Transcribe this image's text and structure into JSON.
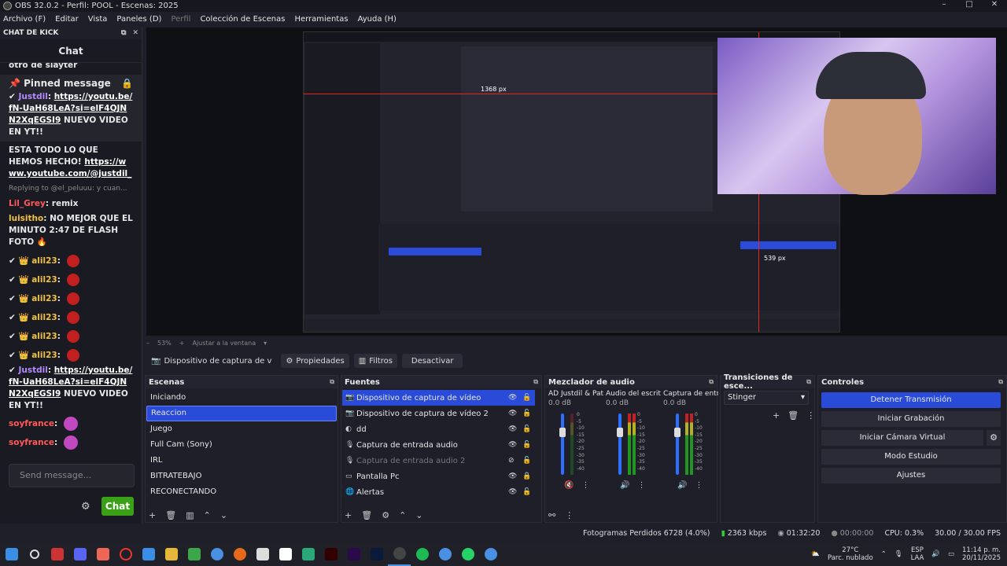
{
  "window": {
    "title": "OBS 32.0.2 - Perfil: POOL - Escenas: 2025",
    "controls": [
      "–",
      "□",
      "✕"
    ]
  },
  "menu": [
    "Archivo (F)",
    "Editar",
    "Vista",
    "Paneles (D)",
    "Perfil",
    "Colección de Escenas",
    "Herramientas",
    "Ayuda (H)"
  ],
  "chat_dock": {
    "header": "CHAT DE KICK",
    "title": "Chat",
    "top_partial": "otro de slayter",
    "pinned": {
      "label": "Pinned message",
      "user": "Justdil",
      "link": "https://youtu.be/fN-UaH68LeA?si=elF4QJNN2XqEGSI9",
      "text": "NUEVO VIDEO EN YT!!"
    },
    "messages": [
      {
        "user": "",
        "text": "ESTA TODO LO QUE HEMOS HECHO!",
        "link": "https://www.youtube.com/@justdil_"
      },
      {
        "user": "",
        "text": "Replying to @el_peluuu: y cuan...",
        "reply": true
      },
      {
        "user": "Lil_Grey",
        "text": "remix"
      },
      {
        "user": "luisitho",
        "text": "NO MEJOR QUE EL MINUTO 2:47 DE FLASH FOTO 🔥"
      },
      {
        "user": "alil23",
        "text": ""
      },
      {
        "user": "alil23",
        "text": ""
      },
      {
        "user": "alil23",
        "text": ""
      },
      {
        "user": "alil23",
        "text": ""
      },
      {
        "user": "alil23",
        "text": ""
      },
      {
        "user": "alil23",
        "text": ""
      },
      {
        "user": "Justdil",
        "text": "NUEVO VIDEO EN YT!!",
        "link": "https://youtu.be/fN-UaH68LeA?si=elF4QJNN2XqEGSI9"
      },
      {
        "user": "soyfrance",
        "text": ""
      },
      {
        "user": "soyfrance",
        "text": ""
      }
    ],
    "input_placeholder": "Send message...",
    "chat_button": "Chat"
  },
  "zoom": {
    "value": "53%",
    "fit": "Ajustar a la ventana"
  },
  "source_toolbar": {
    "source": "Dispositivo de captura de v",
    "properties": "Propiedades",
    "filters": "Filtros",
    "deactivate": "Desactivar"
  },
  "scenes": {
    "title": "Escenas",
    "items": [
      "Iniciando",
      "Reaccion",
      "Juego",
      "Full Cam (Sony)",
      "IRL",
      "BITRATEBAJO",
      "RECONECTANDO"
    ],
    "selected": 1
  },
  "sources": {
    "title": "Fuentes",
    "items": [
      {
        "name": "Dispositivo de captura de vídeo",
        "icon": "camera-icon",
        "visible": true
      },
      {
        "name": "Dispositivo de captura de vídeo 2",
        "icon": "camera-icon",
        "visible": true
      },
      {
        "name": "dd",
        "icon": "circle-icon",
        "visible": true
      },
      {
        "name": "Captura de entrada audio",
        "icon": "mic-icon",
        "visible": true
      },
      {
        "name": "Captura de entrada audio 2",
        "icon": "mic-icon",
        "visible": false
      },
      {
        "name": "Pantalla Pc",
        "icon": "monitor-icon",
        "visible": true
      },
      {
        "name": "Alertas",
        "icon": "globe-icon",
        "visible": true
      }
    ]
  },
  "mixer": {
    "title": "Mezclador de audio",
    "channels": [
      {
        "name": "AD Justdil & Patroc",
        "db": "0.0 dB",
        "level": 0.5
      },
      {
        "name": "Audio del escritorio",
        "db": "0.0 dB",
        "level": 0.5
      },
      {
        "name": "Captura de entrada",
        "db": "0.0 dB",
        "level": 0.5
      }
    ],
    "scale": [
      "0",
      "-5",
      "-10",
      "-15",
      "-20",
      "-25",
      "-30",
      "-35",
      "-40",
      "-45",
      "-50",
      "-55",
      "-60"
    ]
  },
  "transitions": {
    "title": "Transiciones de esce...",
    "selected": "Stinger"
  },
  "controls": {
    "title": "Controles",
    "buttons": [
      "Detener Transmisión",
      "Iniciar Grabación",
      "Iniciar Cámara Virtual",
      "Modo Estudio",
      "Ajustes"
    ]
  },
  "status": {
    "dropped": "Fotogramas Perdidos 6728 (4.0%)",
    "bitrate": "2363 kbps",
    "live_time": "01:32:20",
    "rec_time": "00:00:00",
    "cpu": "CPU: 0.3%",
    "fps": "30.00 / 30.00 FPS"
  },
  "tray": {
    "weather_temp": "27°C",
    "weather_desc": "Parc. nublado",
    "lang1": "ESP",
    "lang2": "LAA",
    "time": "11:14 p. m.",
    "date": "20/11/2025"
  },
  "preview_overlay": {
    "px1": "1368 px",
    "px2": "539 px"
  }
}
